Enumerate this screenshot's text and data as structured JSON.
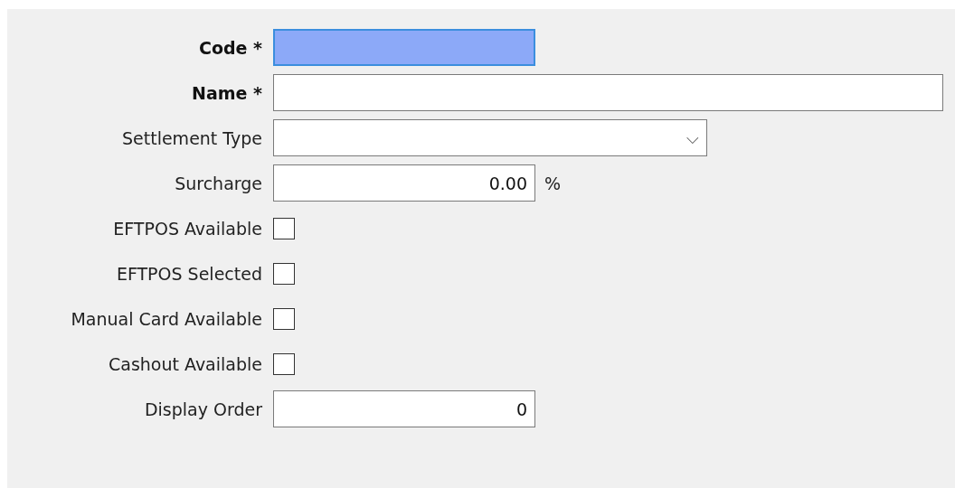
{
  "fields": [
    {
      "kind": "text",
      "label": "Code *",
      "required": true,
      "focused": true
    },
    {
      "kind": "wide-text",
      "label": "Name *",
      "required": true,
      "focused": false
    },
    {
      "kind": "select",
      "label": "Settlement Type",
      "required": false,
      "focused": false,
      "icon": "⌵"
    },
    {
      "kind": "number",
      "label": "Surcharge",
      "required": false,
      "focused": false,
      "value": "0.00",
      "unit": "%"
    },
    {
      "kind": "checkbox",
      "label": "EFTPOS Available",
      "required": false,
      "checked": false
    },
    {
      "kind": "checkbox",
      "label": "EFTPOS Selected",
      "required": false,
      "checked": false
    },
    {
      "kind": "checkbox",
      "label": "Manual Card Available",
      "required": false,
      "checked": false
    },
    {
      "kind": "checkbox",
      "label": "Cashout Available",
      "required": false,
      "checked": false
    },
    {
      "kind": "number",
      "label": "Display Order",
      "required": false,
      "focused": false,
      "value": "0"
    }
  ]
}
